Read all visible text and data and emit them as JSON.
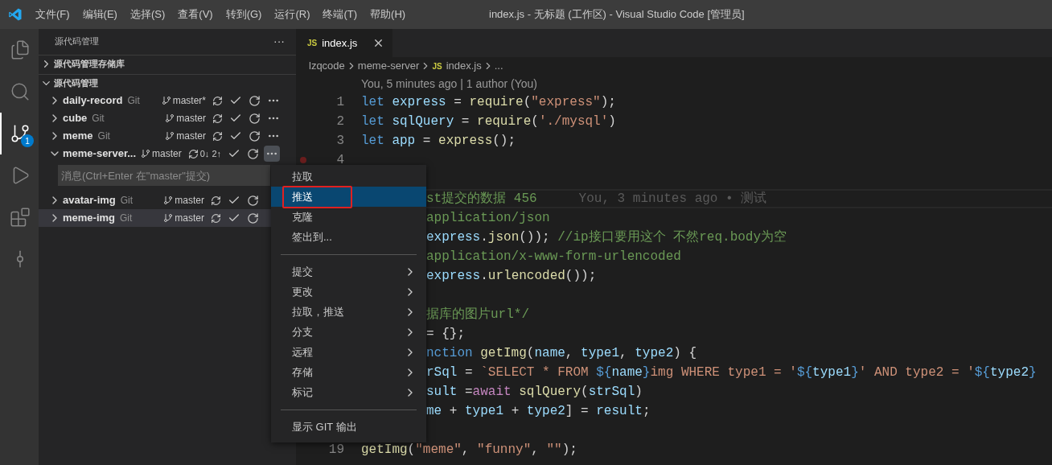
{
  "window": {
    "title": "index.js - 无标题 (工作区) - Visual Studio Code [管理员]"
  },
  "menu_bar": [
    "文件(F)",
    "编辑(E)",
    "选择(S)",
    "查看(V)",
    "转到(G)",
    "运行(R)",
    "终端(T)",
    "帮助(H)"
  ],
  "activity_bar": [
    {
      "kind": "files",
      "selected": false
    },
    {
      "kind": "search",
      "selected": false
    },
    {
      "kind": "scm",
      "selected": true,
      "badge": "1"
    },
    {
      "kind": "debug",
      "selected": false
    },
    {
      "kind": "extensions",
      "selected": false
    },
    {
      "kind": "graph",
      "selected": false
    }
  ],
  "sidebar": {
    "title": "源代码管理",
    "more": "···",
    "sections": [
      {
        "title": "源代码管理存储库",
        "expanded": false
      },
      {
        "title": "源代码管理",
        "expanded": true
      }
    ],
    "repos": [
      {
        "name": "daily-record",
        "type": "Git",
        "branch": "master*",
        "expanded": false,
        "selected": false,
        "more_button": {
          "open": false
        }
      },
      {
        "name": "cube",
        "type": "Git",
        "branch": "master",
        "expanded": false,
        "selected": false,
        "more_button": {
          "open": false
        }
      },
      {
        "name": "meme",
        "type": "Git",
        "branch": "master",
        "expanded": false,
        "selected": false,
        "more_button": {
          "open": false
        }
      },
      {
        "name": "meme-server...",
        "branch": "master",
        "sync": "0↓ 2↑",
        "expanded": true,
        "selected": false,
        "more_button": {
          "open": true
        },
        "message": {
          "placeholder": "消息(Ctrl+Enter 在\"master\"提交)"
        }
      },
      {
        "name": "avatar-img",
        "type": "Git",
        "branch": "master",
        "expanded": false,
        "selected": false
      },
      {
        "name": "meme-img",
        "type": "Git",
        "branch": "master",
        "expanded": false,
        "selected": true
      }
    ]
  },
  "editor": {
    "tabs": [
      {
        "label": "index.js",
        "icon": "JS",
        "selected": true
      }
    ],
    "breadcrumb": [
      "lzqcode",
      "meme-server",
      "index.js",
      "..."
    ],
    "breadcrumb_icon": "JS",
    "codelens": "You, 5 minutes ago | 1 author (You)",
    "lines": [
      {
        "kind": "code",
        "number": "1",
        "segments": [
          {
            "kind": "keyword",
            "text": "let"
          },
          {
            "kind": "var",
            "text": " express"
          },
          {
            "kind": "plain",
            "text": " = "
          },
          {
            "kind": "func",
            "text": "require"
          },
          {
            "kind": "plain",
            "text": "("
          },
          {
            "kind": "string",
            "text": "\"express\""
          },
          {
            "kind": "plain",
            "text": ");"
          }
        ]
      },
      {
        "kind": "code",
        "number": "2",
        "segments": [
          {
            "kind": "keyword",
            "text": "let"
          },
          {
            "kind": "var",
            "text": " sqlQuery"
          },
          {
            "kind": "plain",
            "text": " = "
          },
          {
            "kind": "func",
            "text": "require"
          },
          {
            "kind": "plain",
            "text": "("
          },
          {
            "kind": "string",
            "text": "'./mysql'"
          },
          {
            "kind": "plain",
            "text": ")"
          }
        ]
      },
      {
        "kind": "code",
        "number": "3",
        "segments": [
          {
            "kind": "keyword",
            "text": "let"
          },
          {
            "kind": "var",
            "text": " app"
          },
          {
            "kind": "plain",
            "text": " = "
          },
          {
            "kind": "func",
            "text": "express"
          },
          {
            "kind": "plain",
            "text": "();"
          }
        ]
      },
      {
        "kind": "code",
        "number": "4",
        "breakpoint": true
      },
      {
        "kind": "blank"
      },
      {
        "kind": "code",
        "partial": true,
        "current": true,
        "blame": "You, 3 minutes ago • 测试",
        "segments": [
          {
            "kind": "comment",
            "text": "st提交的数据 456"
          }
        ]
      },
      {
        "kind": "code",
        "partial": true,
        "segments": [
          {
            "kind": "comment",
            "text": "application/json"
          }
        ]
      },
      {
        "kind": "code",
        "partial": true,
        "segments": [
          {
            "kind": "var",
            "text": "express"
          },
          {
            "kind": "plain",
            "text": "."
          },
          {
            "kind": "func",
            "text": "json"
          },
          {
            "kind": "plain",
            "text": "()); "
          },
          {
            "kind": "comment",
            "text": "//ip接口要用这个 不然req.body为空"
          }
        ]
      },
      {
        "kind": "code",
        "partial": true,
        "segments": [
          {
            "kind": "comment",
            "text": "application/x-www-form-urlencoded"
          }
        ]
      },
      {
        "kind": "code",
        "partial": true,
        "segments": [
          {
            "kind": "var",
            "text": "express"
          },
          {
            "kind": "plain",
            "text": "."
          },
          {
            "kind": "func",
            "text": "urlencoded"
          },
          {
            "kind": "plain",
            "text": "());"
          }
        ]
      },
      {
        "kind": "blank"
      },
      {
        "kind": "code",
        "partial": true,
        "segments": [
          {
            "kind": "comment",
            "text": "据库的图片url*/"
          }
        ]
      },
      {
        "kind": "code",
        "partial": true,
        "segments": [
          {
            "kind": "plain",
            "text": "= {};"
          }
        ]
      },
      {
        "kind": "code",
        "partial": true,
        "segments": [
          {
            "kind": "keyword",
            "text": "nction"
          },
          {
            "kind": "func",
            "text": " getImg"
          },
          {
            "kind": "plain",
            "text": "("
          },
          {
            "kind": "var",
            "text": "name"
          },
          {
            "kind": "plain",
            "text": ", "
          },
          {
            "kind": "var",
            "text": "type1"
          },
          {
            "kind": "plain",
            "text": ", "
          },
          {
            "kind": "var",
            "text": "type2"
          },
          {
            "kind": "plain",
            "text": ") {"
          }
        ]
      },
      {
        "kind": "code",
        "partial": true,
        "segments": [
          {
            "kind": "var",
            "text": "rSql"
          },
          {
            "kind": "plain",
            "text": " = "
          },
          {
            "kind": "string",
            "text": "`SELECT * FROM "
          },
          {
            "kind": "keyword",
            "text": "${"
          },
          {
            "kind": "var",
            "text": "name"
          },
          {
            "kind": "keyword",
            "text": "}"
          },
          {
            "kind": "string",
            "text": "img WHERE type1 = '"
          },
          {
            "kind": "keyword",
            "text": "${"
          },
          {
            "kind": "var",
            "text": "type1"
          },
          {
            "kind": "keyword",
            "text": "}"
          },
          {
            "kind": "string",
            "text": "' AND type2 = '"
          },
          {
            "kind": "keyword",
            "text": "${"
          },
          {
            "kind": "var",
            "text": "type2"
          },
          {
            "kind": "keyword",
            "text": "}"
          }
        ]
      },
      {
        "kind": "code",
        "partial": true,
        "segments": [
          {
            "kind": "var",
            "text": "sult"
          },
          {
            "kind": "plain",
            "text": " ="
          },
          {
            "kind": "control",
            "text": "await"
          },
          {
            "kind": "func",
            "text": " sqlQuery"
          },
          {
            "kind": "plain",
            "text": "("
          },
          {
            "kind": "var",
            "text": "strSql"
          },
          {
            "kind": "plain",
            "text": ")"
          }
        ]
      },
      {
        "kind": "code",
        "partial": true,
        "segments": [
          {
            "kind": "var",
            "text": "me"
          },
          {
            "kind": "plain",
            "text": " + "
          },
          {
            "kind": "var",
            "text": "type1"
          },
          {
            "kind": "plain",
            "text": " + "
          },
          {
            "kind": "var",
            "text": "type2"
          },
          {
            "kind": "plain",
            "text": "] = "
          },
          {
            "kind": "var",
            "text": "result"
          },
          {
            "kind": "plain",
            "text": ";"
          }
        ]
      },
      {
        "kind": "blank"
      },
      {
        "kind": "code",
        "number": "19",
        "segments": [
          {
            "kind": "func",
            "text": "getImg"
          },
          {
            "kind": "plain",
            "text": "("
          },
          {
            "kind": "string",
            "text": "\"meme\""
          },
          {
            "kind": "plain",
            "text": ", "
          },
          {
            "kind": "string",
            "text": "\"funny\""
          },
          {
            "kind": "plain",
            "text": ", "
          },
          {
            "kind": "string",
            "text": "\"\""
          },
          {
            "kind": "plain",
            "text": ");"
          }
        ]
      }
    ]
  },
  "context_menu": {
    "groups": [
      [
        {
          "label": "拉取",
          "selected": false,
          "submenu": false,
          "annotated": false
        },
        {
          "label": "推送",
          "selected": true,
          "submenu": false,
          "annotated": true
        },
        {
          "label": "克隆",
          "selected": false,
          "submenu": false,
          "annotated": false
        },
        {
          "label": "签出到...",
          "selected": false,
          "submenu": false,
          "annotated": false
        }
      ],
      [
        {
          "label": "提交",
          "selected": false,
          "submenu": true,
          "annotated": false
        },
        {
          "label": "更改",
          "selected": false,
          "submenu": true,
          "annotated": false
        },
        {
          "label": "拉取，推送",
          "selected": false,
          "submenu": true,
          "annotated": false
        },
        {
          "label": "分支",
          "selected": false,
          "submenu": true,
          "annotated": false
        },
        {
          "label": "远程",
          "selected": false,
          "submenu": true,
          "annotated": false
        },
        {
          "label": "存储",
          "selected": false,
          "submenu": true,
          "annotated": false
        },
        {
          "label": "标记",
          "selected": false,
          "submenu": true,
          "annotated": false
        }
      ],
      [
        {
          "label": "显示 GIT 输出",
          "selected": false,
          "submenu": false,
          "annotated": false
        }
      ]
    ]
  }
}
